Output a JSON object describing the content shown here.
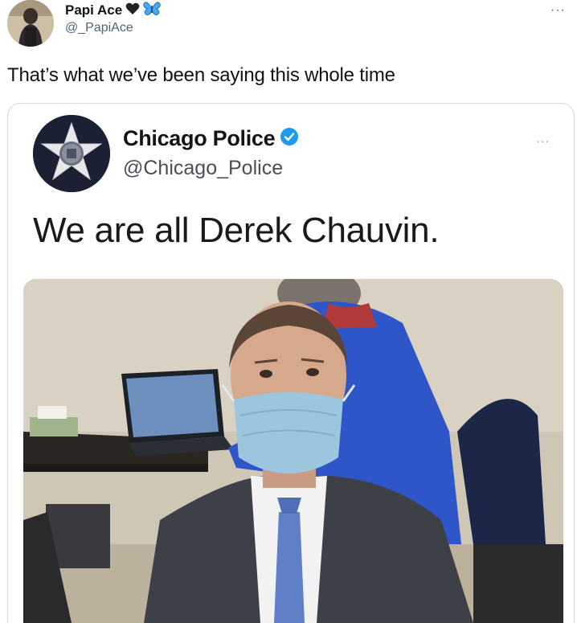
{
  "tweet": {
    "author_name": "Papi Ace",
    "author_emoji": [
      "black-heart-icon",
      "butterfly-icon"
    ],
    "author_handle": "@_PapiAce",
    "more_label": "···",
    "text": "That’s what we’ve been saying this whole time"
  },
  "embedded_tweet": {
    "author_name": "Chicago Police",
    "verified": true,
    "author_handle": "@Chicago_Police",
    "more_label": "···",
    "text": "We are all Derek Chauvin.",
    "image": "photo of a man in a suit wearing a blue surgical mask, seated in a courtroom with a person at a laptop behind him"
  },
  "colors": {
    "text_primary": "#0f1419",
    "text_secondary": "#536471",
    "verified_blue": "#1d9bf0",
    "border": "#cfd9de"
  }
}
